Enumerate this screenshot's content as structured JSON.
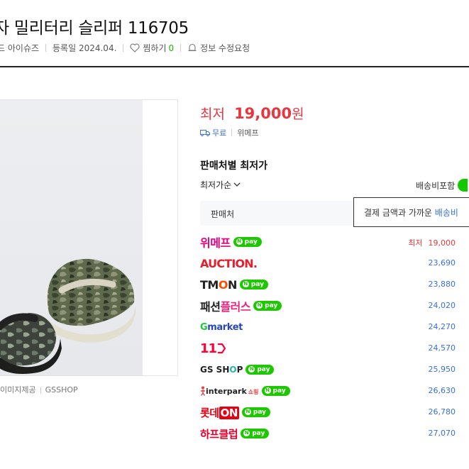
{
  "product": {
    "title": "자 밀리터리 슬리퍼 116705",
    "brand_fragment": "드 아이슈즈",
    "registered": "등록일 2024.04.",
    "wishlist_label": "찜하기",
    "wishlist_count": "0",
    "report_label": "정보 수정요청"
  },
  "image": {
    "caption_source": "이미지제공",
    "caption_shop": "GSSHOP"
  },
  "price": {
    "label": "최저",
    "value": "19,000",
    "unit": "원",
    "shipping": "무료",
    "seller": "위메프"
  },
  "sellers_section": {
    "title": "판매처별 최저가",
    "sort_label": "최저가순",
    "shipping_include_label": "배송비포함",
    "header_label": "판매처",
    "tooltip_text": "결제 금액과 가까운",
    "tooltip_link": "배송비",
    "npay_label": "pay",
    "lowest_tag": "최저",
    "rows": [
      {
        "logo": "위메프",
        "npay": true,
        "price": "19,000"
      },
      {
        "logo": "AUCTION.",
        "npay": false,
        "price": "23,690"
      },
      {
        "logo_a": "TM",
        "logo_b": "O",
        "logo_c": "N",
        "npay": true,
        "price": "23,880"
      },
      {
        "logo_a": "패션",
        "logo_b": "플러스",
        "npay": true,
        "price": "24,020"
      },
      {
        "logo_a": "G",
        "logo_b": "market",
        "npay": false,
        "price": "24,270"
      },
      {
        "logo": "11",
        "npay": false,
        "price": "24,570"
      },
      {
        "logo_a": "GS SH",
        "logo_b": "O",
        "logo_c": "P",
        "npay": true,
        "price": "25,950"
      },
      {
        "logo_a": "interpark",
        "logo_b": "쇼핑",
        "npay": true,
        "price": "26,630"
      },
      {
        "logo_a": "롯데",
        "logo_b": "ON",
        "npay": true,
        "price": "26,780"
      },
      {
        "logo": "하프클럽",
        "npay": true,
        "price": "27,070"
      }
    ]
  },
  "colors": {
    "accent_red": "#e63740",
    "link_blue": "#3a6fd8",
    "naver_green": "#1ec800"
  }
}
